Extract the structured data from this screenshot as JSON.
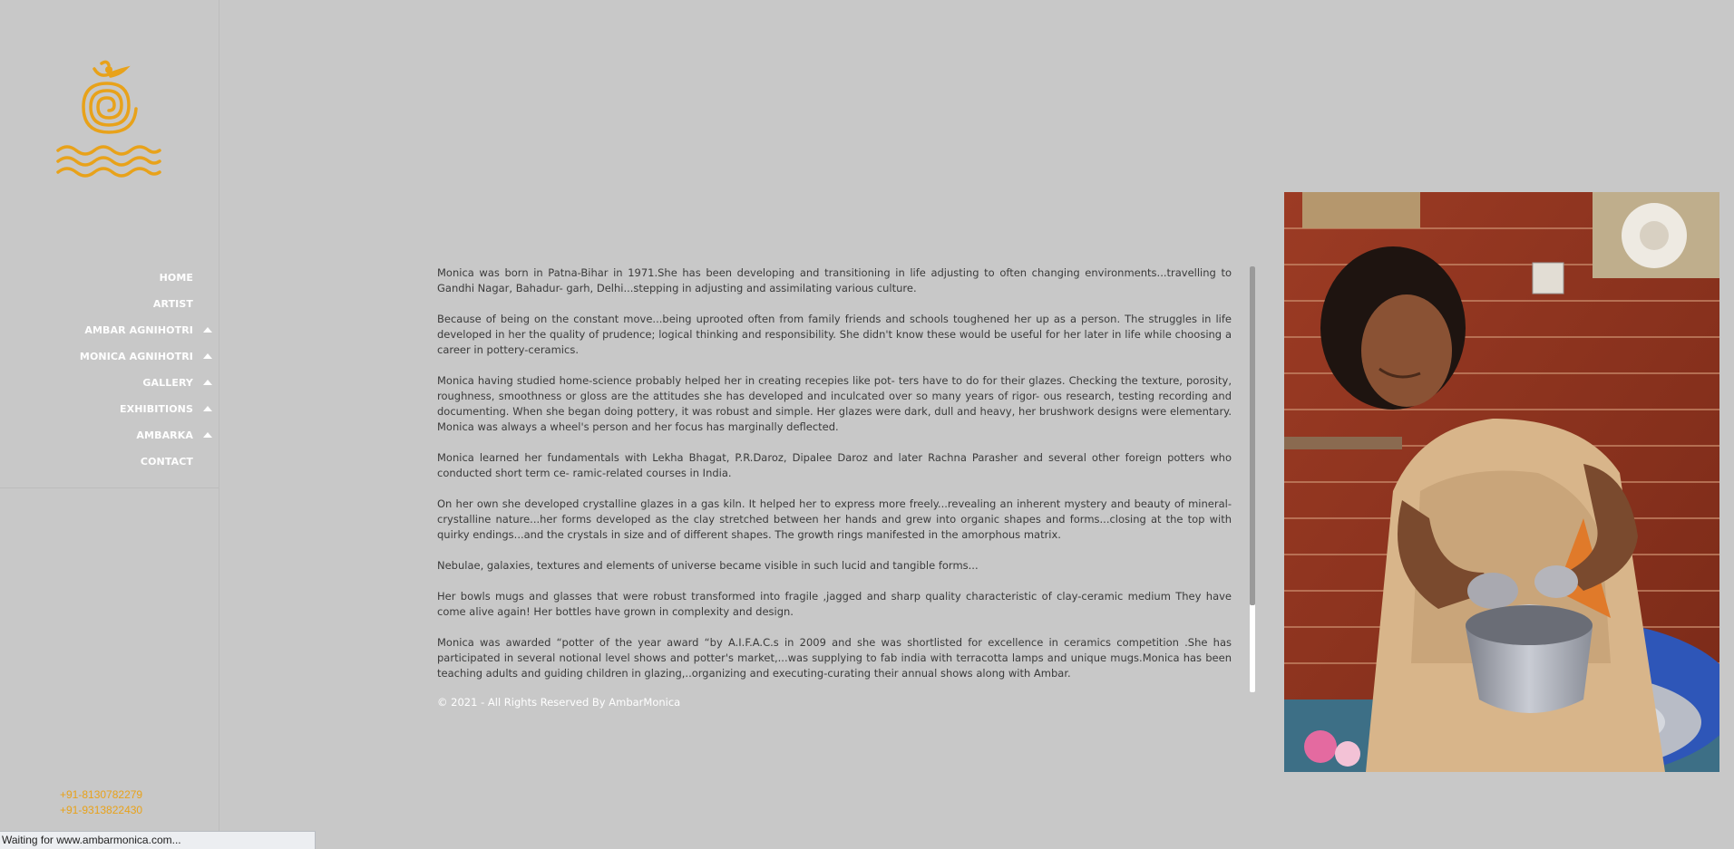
{
  "sidebar": {
    "logo_icon": "om-spiral-waves-logo",
    "brand_color": "#e8a21a",
    "nav": [
      {
        "label": "HOME",
        "has_submenu": false
      },
      {
        "label": "ARTIST",
        "has_submenu": false
      },
      {
        "label": "AMBAR AGNIHOTRI",
        "has_submenu": true
      },
      {
        "label": "MONICA AGNIHOTRI",
        "has_submenu": true
      },
      {
        "label": "GALLERY",
        "has_submenu": true
      },
      {
        "label": "EXHIBITIONS",
        "has_submenu": true
      },
      {
        "label": "AMBARKA",
        "has_submenu": true
      },
      {
        "label": "CONTACT",
        "has_submenu": false
      }
    ],
    "phones": [
      "+91-8130782279",
      "+91-9313822430"
    ]
  },
  "main": {
    "paragraphs": [
      "Monica was born in Patna-Bihar in 1971.She has been developing and transitioning in life adjusting to often changing environments...travelling to Gandhi Nagar, Bahadur- garh, Delhi...stepping in adjusting and assimilating various culture.",
      "Because of being on the constant move...being uprooted often from family friends and schools toughened her up as a person. The struggles in life developed in her the quality of prudence; logical thinking and responsibility. She didn't know these would be useful for her later in life while choosing a career in pottery-ceramics.",
      "Monica having studied home-science probably helped her in creating recepies like pot- ters have to do for their glazes. Checking the texture, porosity, roughness, smoothness or gloss are the attitudes she has developed and inculcated over so many years of rigor- ous research, testing recording and documenting. When she began doing pottery, it was robust and simple. Her glazes were dark, dull and heavy, her brushwork designs were elementary. Monica was always a wheel's person and her focus has marginally deflected.",
      "Monica learned her fundamentals with Lekha Bhagat, P.R.Daroz, Dipalee Daroz and later Rachna Parasher and several other foreign potters who conducted short term ce- ramic-related courses in India.",
      "On her own she developed crystalline glazes in a gas kiln. It helped her to express more freely...revealing an inherent mystery and beauty of mineral-crystalline nature...her forms developed as the clay stretched between her hands and grew into organic shapes and forms...closing at the top with quirky endings...and the crystals in size and of different shapes. The growth rings manifested in the amorphous matrix.",
      "Nebulae, galaxies, textures and elements of universe became visible in such lucid and tangible forms...",
      "Her bowls mugs and glasses that were robust transformed into fragile ,jagged and sharp quality characteristic of clay-ceramic medium They have come alive again! Her bottles have grown in complexity and design.",
      "Monica was awarded “potter of the year award “by A.I.F.A.C.s in 2009 and she was shortlisted for excellence in ceramics competition .She has participated in several notional level shows and potter's market,...was supplying to fab india with terracotta lamps and unique mugs.Monica has been teaching adults and guiding children in glazing,..organizing and executing-curating their annual shows along with Ambar."
    ],
    "copyright": "© 2021 - All Rights Reserved By AmbarMonica"
  },
  "photo": {
    "subject": "potter-at-wheel-photo"
  },
  "status_bar": {
    "text": "Waiting for www.ambarmonica.com..."
  }
}
